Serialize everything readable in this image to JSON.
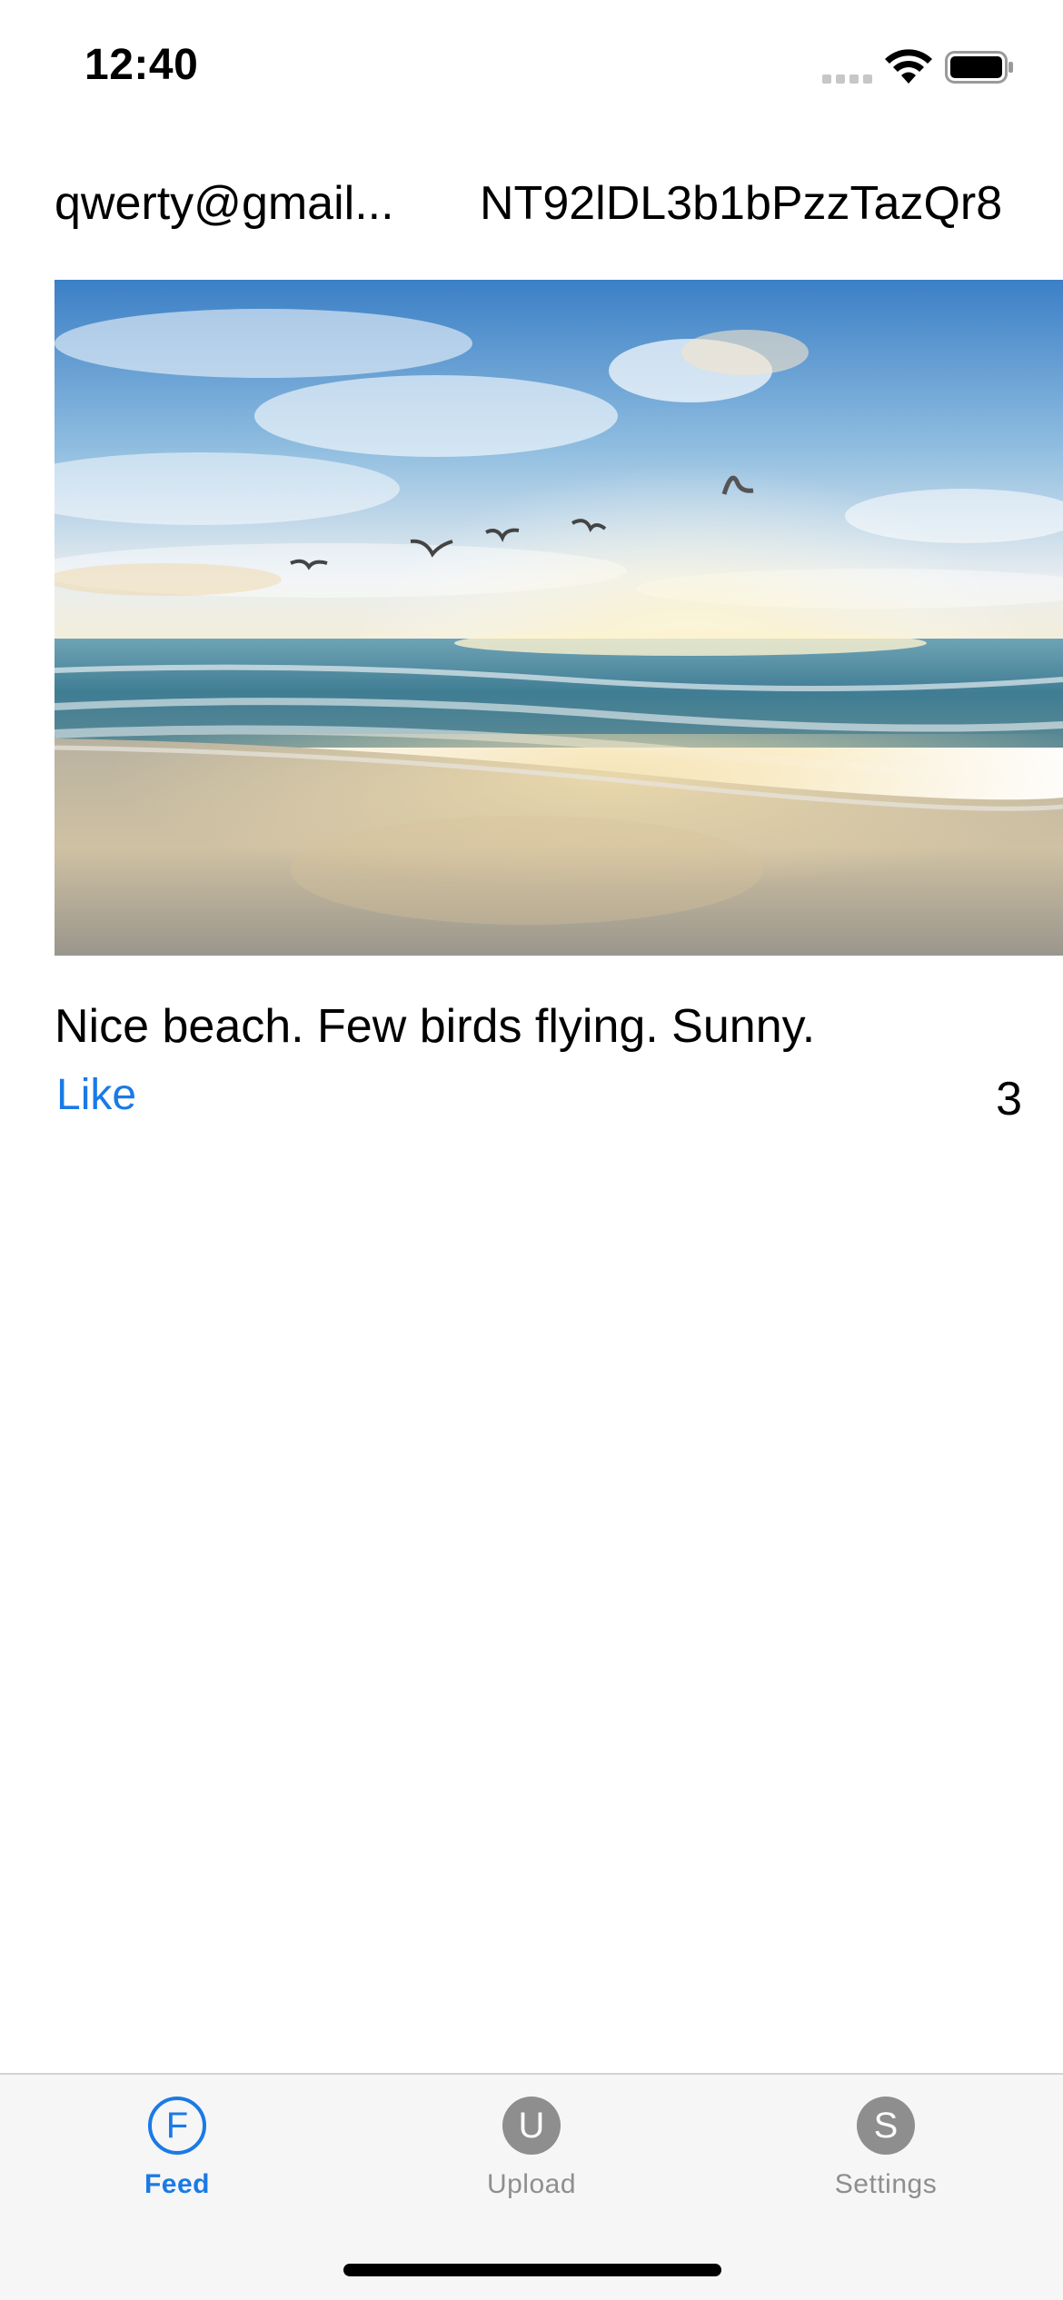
{
  "status_bar": {
    "time": "12:40",
    "icons": [
      "signal-icon",
      "wifi-icon",
      "battery-icon"
    ]
  },
  "header": {
    "user_email": "qwerty@gmail...",
    "user_id": "NT92lDL3b1bPzzTazQr8"
  },
  "post": {
    "image": "beach-sunset-with-birds",
    "caption": "Nice beach. Few birds flying. Sunny.",
    "like_label": "Like",
    "like_count": "3"
  },
  "tab_bar": {
    "tabs": [
      {
        "letter": "F",
        "label": "Feed",
        "active": true
      },
      {
        "letter": "U",
        "label": "Upload",
        "active": false
      },
      {
        "letter": "S",
        "label": "Settings",
        "active": false
      }
    ],
    "active_color": "#1a7ae6",
    "inactive_color": "#8e8e8e"
  }
}
